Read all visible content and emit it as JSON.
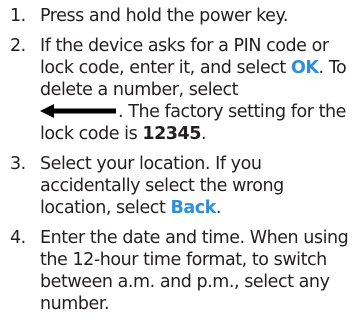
{
  "steps": [
    {
      "number": "1.",
      "text": "Press and hold the power key."
    },
    {
      "number": "2.",
      "text_a": "If the device asks for a PIN code or lock code, enter it, and select ",
      "ok_link": "OK",
      "text_b": ". To delete a number, select",
      "text_c": ". The factory setting for the lock code is ",
      "code": "12345",
      "text_d": ".",
      "icon": "backspace-arrow-icon"
    },
    {
      "number": "3.",
      "text_a": "Select your location. If you accidentally select the wrong location, select ",
      "back_link": "Back",
      "text_b": "."
    },
    {
      "number": "4.",
      "text": "Enter the date and time. When using the 12-hour time format, to switch between a.m. and p.m., select any number."
    }
  ],
  "colors": {
    "text": "#231f20",
    "link": "#2f8fd8"
  }
}
